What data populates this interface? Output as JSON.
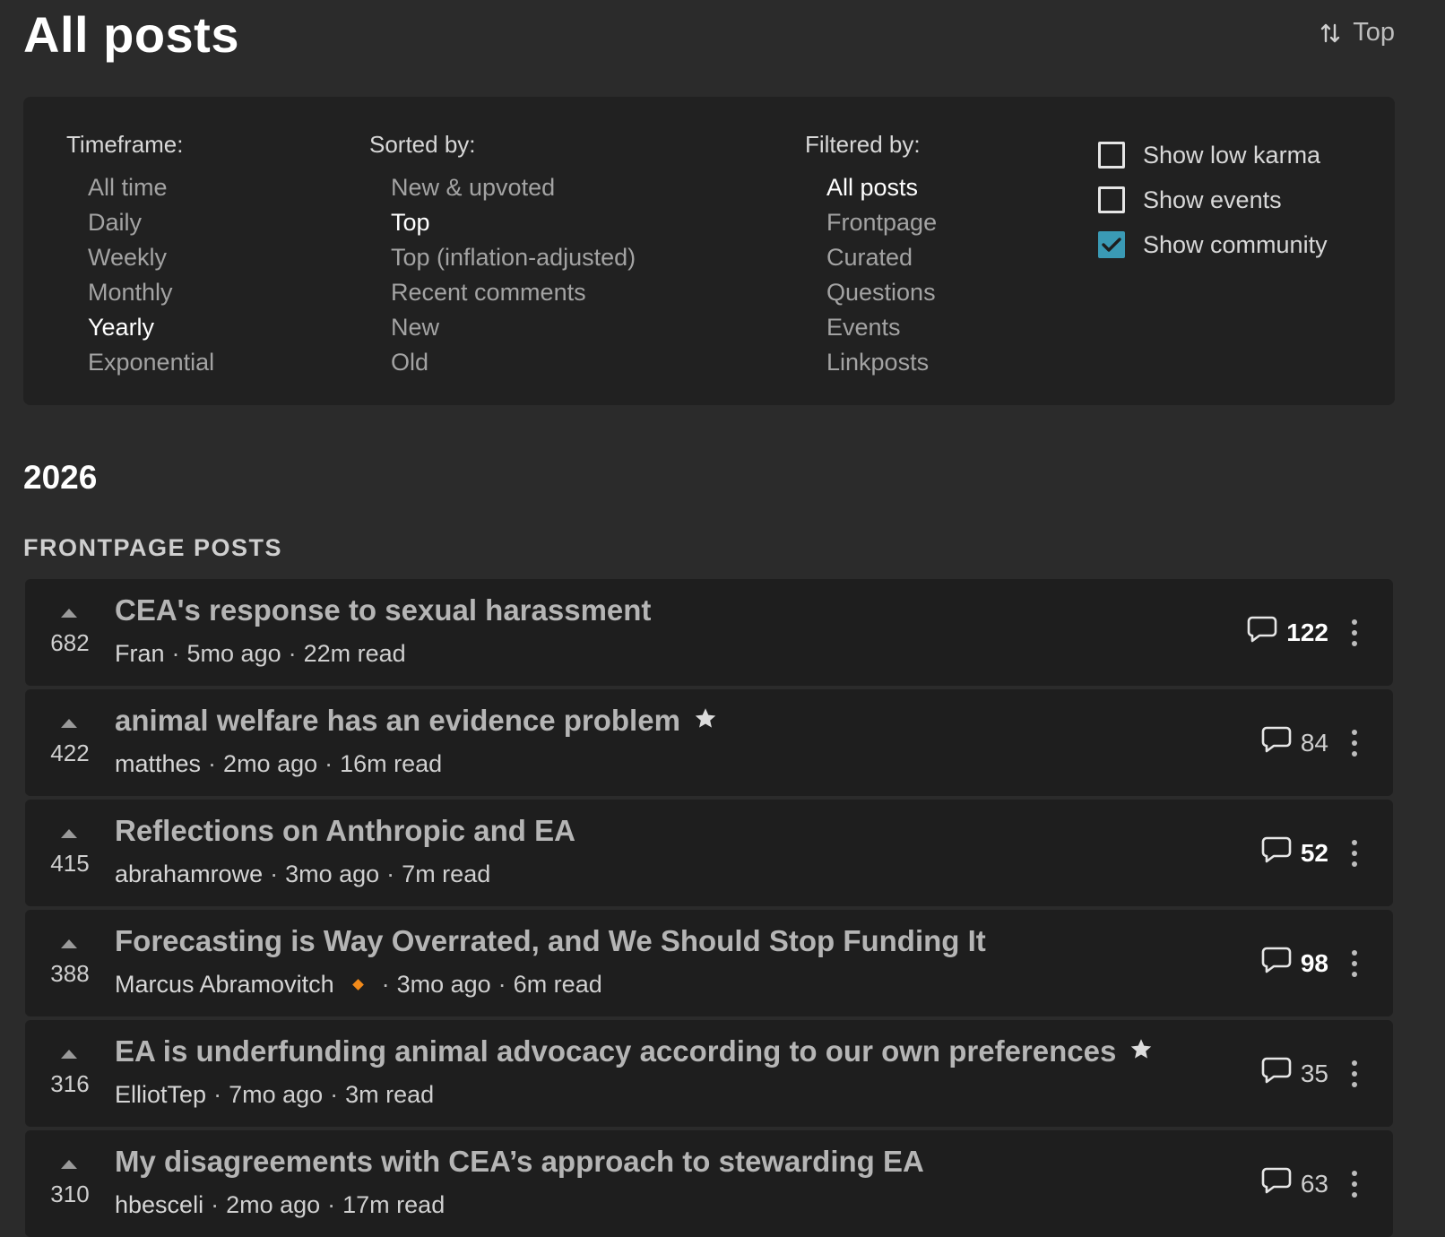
{
  "header": {
    "title": "All posts",
    "sort_label": "Top"
  },
  "settings": {
    "timeframe": {
      "title": "Timeframe:",
      "options": [
        "All time",
        "Daily",
        "Weekly",
        "Monthly",
        "Yearly",
        "Exponential"
      ],
      "selected": "Yearly"
    },
    "sorted_by": {
      "title": "Sorted by:",
      "options": [
        "New & upvoted",
        "Top",
        "Top (inflation-adjusted)",
        "Recent comments",
        "New",
        "Old"
      ],
      "selected": "Top"
    },
    "filtered_by": {
      "title": "Filtered by:",
      "options": [
        "All posts",
        "Frontpage",
        "Curated",
        "Questions",
        "Events",
        "Linkposts"
      ],
      "selected": "All posts"
    },
    "checkboxes": [
      {
        "label": "Show low karma",
        "checked": false
      },
      {
        "label": "Show events",
        "checked": false
      },
      {
        "label": "Show community",
        "checked": true
      }
    ]
  },
  "year": "2026",
  "section": "FRONTPAGE POSTS",
  "posts": [
    {
      "karma": "682",
      "title": "CEA's response to sexual harassment",
      "starred": false,
      "author": "Fran",
      "diamond": false,
      "age": "5mo ago",
      "read": "22m read",
      "comments": "122",
      "comments_bold": true
    },
    {
      "karma": "422",
      "title": "animal welfare has an evidence problem",
      "starred": true,
      "author": "matthes",
      "diamond": false,
      "age": "2mo ago",
      "read": "16m read",
      "comments": "84",
      "comments_bold": false
    },
    {
      "karma": "415",
      "title": "Reflections on Anthropic and EA",
      "starred": false,
      "author": "abrahamrowe",
      "diamond": false,
      "age": "3mo ago",
      "read": "7m read",
      "comments": "52",
      "comments_bold": true
    },
    {
      "karma": "388",
      "title": "Forecasting is Way Overrated, and We Should Stop Funding It",
      "starred": false,
      "author": "Marcus Abramovitch",
      "diamond": true,
      "age": "3mo ago",
      "read": "6m read",
      "comments": "98",
      "comments_bold": true
    },
    {
      "karma": "316",
      "title": "EA is underfunding animal advocacy according to our own preferences",
      "starred": true,
      "author": "ElliotTep",
      "diamond": false,
      "age": "7mo ago",
      "read": "3m read",
      "comments": "35",
      "comments_bold": false
    },
    {
      "karma": "310",
      "title": "My disagreements with CEA’s approach to stewarding EA",
      "starred": false,
      "author": "hbesceli",
      "diamond": false,
      "age": "2mo ago",
      "read": "17m read",
      "comments": "63",
      "comments_bold": false
    }
  ],
  "colors": {
    "background": "#2b2b2b",
    "panel": "#212121",
    "card": "#1e1e1e",
    "checkbox_accent": "#3a9ab5",
    "diamond": "#f28a1a"
  }
}
